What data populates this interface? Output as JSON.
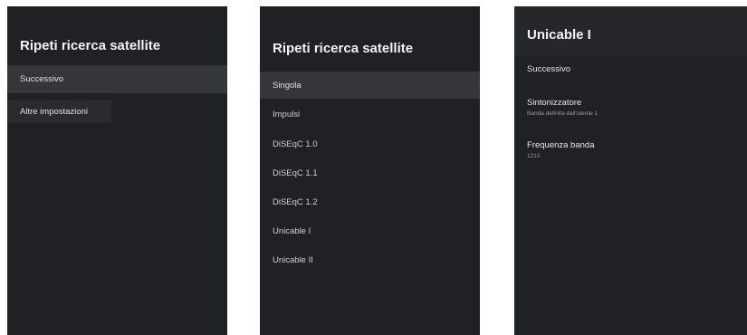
{
  "panel1": {
    "title": "Ripeti ricerca satellite",
    "items": [
      {
        "label": "Successivo"
      },
      {
        "label": "Altre impostazioni"
      }
    ]
  },
  "panel2": {
    "title": "Ripeti ricerca satellite",
    "items": [
      {
        "label": "Singola"
      },
      {
        "label": "Impulsi"
      },
      {
        "label": "DiSEqC 1.0"
      },
      {
        "label": "DiSEqC 1.1"
      },
      {
        "label": "DiSEqC 1.2"
      },
      {
        "label": "Unicable I"
      },
      {
        "label": "Unicable II"
      }
    ],
    "selected": "Singola"
  },
  "panel3": {
    "title": "Unicable I",
    "next_label": "Successivo",
    "tuner": {
      "label": "Sintonizzatore",
      "value": "Banda definita dall'utente 1"
    },
    "band_freq": {
      "label": "Frequenza banda",
      "value": "1210"
    }
  }
}
